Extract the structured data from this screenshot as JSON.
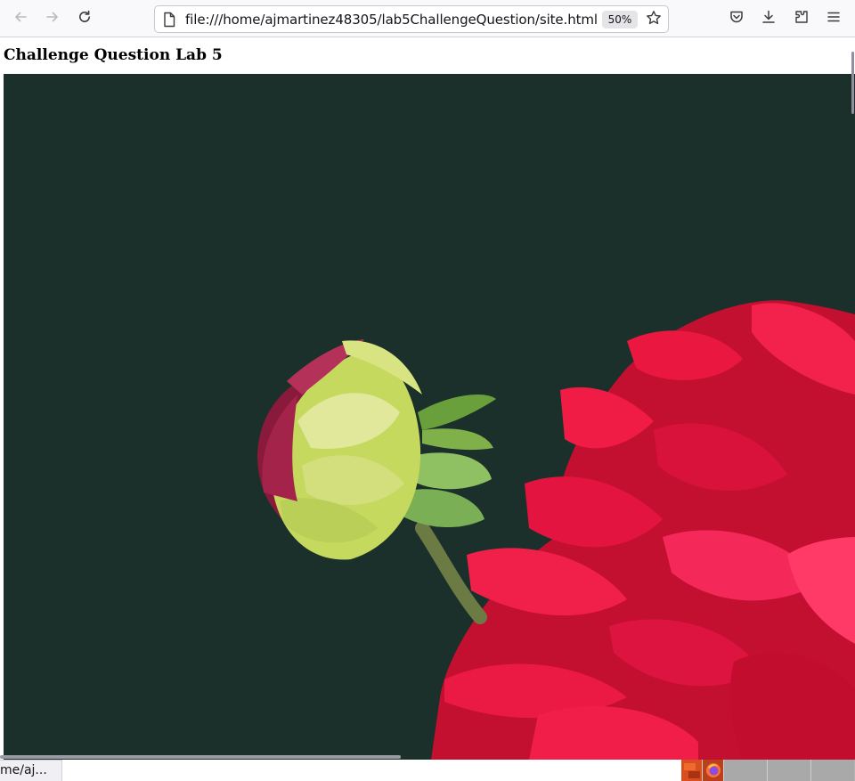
{
  "browser": {
    "url": "file:///home/ajmartinez48305/lab5ChallengeQuestion/site.html",
    "zoom": "50%",
    "icons": {
      "back": "arrow-left-icon",
      "forward": "arrow-right-icon",
      "reload": "reload-icon",
      "page": "document-icon",
      "bookmark": "star-icon",
      "pocket": "pocket-icon",
      "downloads": "download-icon",
      "extensions": "puzzle-icon",
      "menu": "hamburger-menu-icon"
    }
  },
  "page": {
    "heading": "Challenge Question Lab 5",
    "image": {
      "subject": "dahlia-flower-photo",
      "background_color": "#1b302b",
      "bloom_color": "#e8173f",
      "bud_color": "#c9dd63"
    }
  },
  "status": {
    "link_text": "me/aj..."
  },
  "taskbar": {
    "icons": [
      "ubuntu-workspace-icon",
      "firefox-icon"
    ]
  }
}
